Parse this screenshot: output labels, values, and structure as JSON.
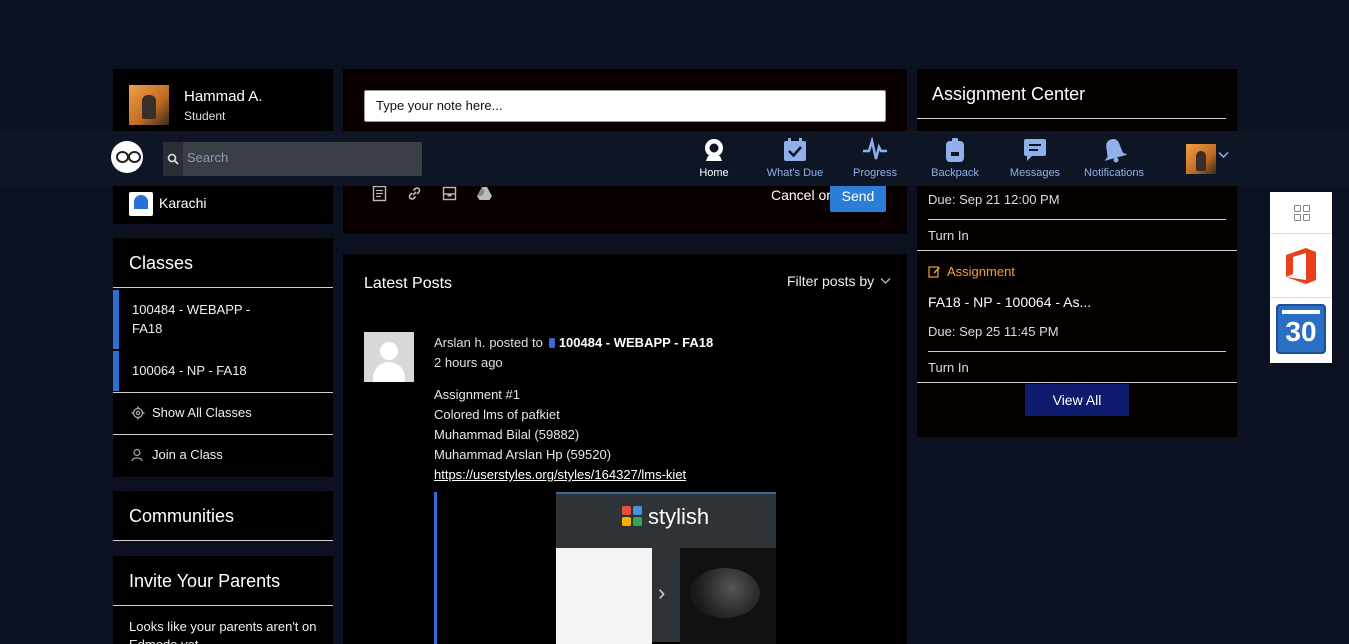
{
  "profile": {
    "name": "Hammad A.",
    "role": "Student"
  },
  "school": {
    "name": "Karachi"
  },
  "classes": {
    "title": "Classes",
    "items": [
      {
        "label_line1": "100484 - WEBAPP -",
        "label_line2": "FA18"
      },
      {
        "label_line1": "100064 - NP - FA18"
      }
    ],
    "show_all": "Show All Classes",
    "join": "Join a Class"
  },
  "communities": {
    "title": "Communities"
  },
  "parents": {
    "title": "Invite Your Parents",
    "text": "Looks like your parents aren't on Edmodo yet."
  },
  "note": {
    "placeholder": "Type your note here...",
    "cancel_text": "Cancel or",
    "send_label": "Send"
  },
  "posts": {
    "title": "Latest Posts",
    "filter_label": "Filter posts by",
    "post": {
      "author": "Arslan h.",
      "posted_to": "posted to",
      "group": "100484 - WEBAPP - FA18",
      "time": "2 hours ago",
      "lines": [
        "Assignment #1",
        "Colored lms of pafkiet",
        "Muhammad Bilal (59882)",
        "Muhammad Arslan Hp (59520)"
      ],
      "link": "https://userstyles.org/styles/164327/lms-kiet",
      "preview_brand": "stylish"
    }
  },
  "navbar": {
    "search_placeholder": "Search",
    "items": [
      {
        "label": "Home",
        "icon": "home-icon"
      },
      {
        "label": "What's Due",
        "icon": "calendar-check-icon"
      },
      {
        "label": "Progress",
        "icon": "pulse-icon"
      },
      {
        "label": "Backpack",
        "icon": "backpack-icon"
      },
      {
        "label": "Messages",
        "icon": "message-icon"
      },
      {
        "label": "Notifications",
        "icon": "bell-icon"
      }
    ]
  },
  "assignments": {
    "title": "Assignment Center",
    "first_due": "Due: Sep 21 12:00 PM",
    "first_action": "Turn In",
    "second_type": "Assignment",
    "second_name": "FA18 - NP - 100064 - As...",
    "second_due": "Due: Sep 25 11:45 PM",
    "second_action": "Turn In",
    "view_all": "View All"
  },
  "apps": {
    "calendar_day": "30"
  },
  "colors": {
    "accent": "#2b7ed8",
    "class_bar": "#2e6fd3",
    "assignment_orange": "#f0a040",
    "view_all_bg": "#0d1a6e"
  }
}
